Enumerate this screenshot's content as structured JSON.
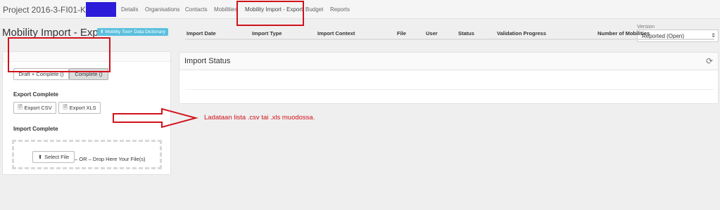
{
  "topnav": {
    "project": "Project 2016-3-FI01-KA105",
    "items": [
      {
        "label": "Details"
      },
      {
        "label": "Organisations"
      },
      {
        "label": "Contacts"
      },
      {
        "label": "Mobilities"
      },
      {
        "label": "Mobility Import - Export",
        "active": true
      },
      {
        "label": "Budget"
      },
      {
        "label": "Reports"
      }
    ]
  },
  "header": {
    "title": "Mobility Import - Export",
    "dictionary_button": "Mobility Tool+ Data Dictionary",
    "version_label": "Version",
    "version_value": "Reported   (Open)"
  },
  "left": {
    "tab_draft": "Draft + Complete ()",
    "tab_complete": "Complete ()",
    "export_title": "Export Complete",
    "export_csv": "Export CSV",
    "export_xls": "Export XLS",
    "import_title": "Import Complete",
    "select_file": "Select File",
    "drop_text": "– OR – Drop Here Your File(s)"
  },
  "annotation": {
    "text": "Ladataan lista .csv tai .xls muodossa.",
    "color": "#d0121b"
  },
  "status": {
    "title": "Import Status",
    "columns": [
      "Import Date",
      "Import Type",
      "Import Context",
      "File",
      "User",
      "Status",
      "Validation Progress",
      "Number of Mobilities"
    ]
  },
  "icons": {
    "refresh": "refresh-icon",
    "upload": "upload-icon",
    "document": "document-icon",
    "download": "download-icon"
  }
}
